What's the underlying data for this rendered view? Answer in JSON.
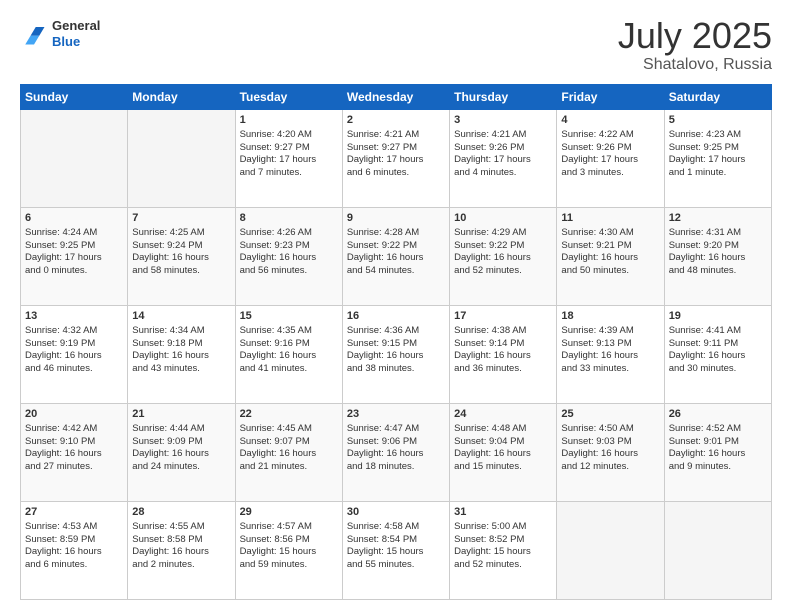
{
  "header": {
    "logo_general": "General",
    "logo_blue": "Blue",
    "title": "July 2025",
    "location": "Shatalovo, Russia"
  },
  "days_of_week": [
    "Sunday",
    "Monday",
    "Tuesday",
    "Wednesday",
    "Thursday",
    "Friday",
    "Saturday"
  ],
  "weeks": [
    [
      {
        "day": "",
        "info": ""
      },
      {
        "day": "",
        "info": ""
      },
      {
        "day": "1",
        "info": "Sunrise: 4:20 AM\nSunset: 9:27 PM\nDaylight: 17 hours\nand 7 minutes."
      },
      {
        "day": "2",
        "info": "Sunrise: 4:21 AM\nSunset: 9:27 PM\nDaylight: 17 hours\nand 6 minutes."
      },
      {
        "day": "3",
        "info": "Sunrise: 4:21 AM\nSunset: 9:26 PM\nDaylight: 17 hours\nand 4 minutes."
      },
      {
        "day": "4",
        "info": "Sunrise: 4:22 AM\nSunset: 9:26 PM\nDaylight: 17 hours\nand 3 minutes."
      },
      {
        "day": "5",
        "info": "Sunrise: 4:23 AM\nSunset: 9:25 PM\nDaylight: 17 hours\nand 1 minute."
      }
    ],
    [
      {
        "day": "6",
        "info": "Sunrise: 4:24 AM\nSunset: 9:25 PM\nDaylight: 17 hours\nand 0 minutes."
      },
      {
        "day": "7",
        "info": "Sunrise: 4:25 AM\nSunset: 9:24 PM\nDaylight: 16 hours\nand 58 minutes."
      },
      {
        "day": "8",
        "info": "Sunrise: 4:26 AM\nSunset: 9:23 PM\nDaylight: 16 hours\nand 56 minutes."
      },
      {
        "day": "9",
        "info": "Sunrise: 4:28 AM\nSunset: 9:22 PM\nDaylight: 16 hours\nand 54 minutes."
      },
      {
        "day": "10",
        "info": "Sunrise: 4:29 AM\nSunset: 9:22 PM\nDaylight: 16 hours\nand 52 minutes."
      },
      {
        "day": "11",
        "info": "Sunrise: 4:30 AM\nSunset: 9:21 PM\nDaylight: 16 hours\nand 50 minutes."
      },
      {
        "day": "12",
        "info": "Sunrise: 4:31 AM\nSunset: 9:20 PM\nDaylight: 16 hours\nand 48 minutes."
      }
    ],
    [
      {
        "day": "13",
        "info": "Sunrise: 4:32 AM\nSunset: 9:19 PM\nDaylight: 16 hours\nand 46 minutes."
      },
      {
        "day": "14",
        "info": "Sunrise: 4:34 AM\nSunset: 9:18 PM\nDaylight: 16 hours\nand 43 minutes."
      },
      {
        "day": "15",
        "info": "Sunrise: 4:35 AM\nSunset: 9:16 PM\nDaylight: 16 hours\nand 41 minutes."
      },
      {
        "day": "16",
        "info": "Sunrise: 4:36 AM\nSunset: 9:15 PM\nDaylight: 16 hours\nand 38 minutes."
      },
      {
        "day": "17",
        "info": "Sunrise: 4:38 AM\nSunset: 9:14 PM\nDaylight: 16 hours\nand 36 minutes."
      },
      {
        "day": "18",
        "info": "Sunrise: 4:39 AM\nSunset: 9:13 PM\nDaylight: 16 hours\nand 33 minutes."
      },
      {
        "day": "19",
        "info": "Sunrise: 4:41 AM\nSunset: 9:11 PM\nDaylight: 16 hours\nand 30 minutes."
      }
    ],
    [
      {
        "day": "20",
        "info": "Sunrise: 4:42 AM\nSunset: 9:10 PM\nDaylight: 16 hours\nand 27 minutes."
      },
      {
        "day": "21",
        "info": "Sunrise: 4:44 AM\nSunset: 9:09 PM\nDaylight: 16 hours\nand 24 minutes."
      },
      {
        "day": "22",
        "info": "Sunrise: 4:45 AM\nSunset: 9:07 PM\nDaylight: 16 hours\nand 21 minutes."
      },
      {
        "day": "23",
        "info": "Sunrise: 4:47 AM\nSunset: 9:06 PM\nDaylight: 16 hours\nand 18 minutes."
      },
      {
        "day": "24",
        "info": "Sunrise: 4:48 AM\nSunset: 9:04 PM\nDaylight: 16 hours\nand 15 minutes."
      },
      {
        "day": "25",
        "info": "Sunrise: 4:50 AM\nSunset: 9:03 PM\nDaylight: 16 hours\nand 12 minutes."
      },
      {
        "day": "26",
        "info": "Sunrise: 4:52 AM\nSunset: 9:01 PM\nDaylight: 16 hours\nand 9 minutes."
      }
    ],
    [
      {
        "day": "27",
        "info": "Sunrise: 4:53 AM\nSunset: 8:59 PM\nDaylight: 16 hours\nand 6 minutes."
      },
      {
        "day": "28",
        "info": "Sunrise: 4:55 AM\nSunset: 8:58 PM\nDaylight: 16 hours\nand 2 minutes."
      },
      {
        "day": "29",
        "info": "Sunrise: 4:57 AM\nSunset: 8:56 PM\nDaylight: 15 hours\nand 59 minutes."
      },
      {
        "day": "30",
        "info": "Sunrise: 4:58 AM\nSunset: 8:54 PM\nDaylight: 15 hours\nand 55 minutes."
      },
      {
        "day": "31",
        "info": "Sunrise: 5:00 AM\nSunset: 8:52 PM\nDaylight: 15 hours\nand 52 minutes."
      },
      {
        "day": "",
        "info": ""
      },
      {
        "day": "",
        "info": ""
      }
    ]
  ]
}
